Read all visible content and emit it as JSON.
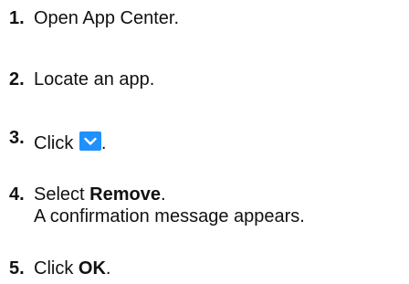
{
  "steps": [
    {
      "number": "1.",
      "text": "Open App Center."
    },
    {
      "number": "2.",
      "text": "Locate an app."
    },
    {
      "number": "3.",
      "text_before": "Click ",
      "icon": "chevron-down-icon",
      "text_after": "."
    },
    {
      "number": "4.",
      "text_before": "Select ",
      "bold": "Remove",
      "text_after": ".",
      "subtext": "A confirmation message appears."
    },
    {
      "number": "5.",
      "text_before": "Click ",
      "bold": "OK",
      "text_after": "."
    }
  ],
  "colors": {
    "text": "#111111",
    "icon_background": "#1e90ff",
    "icon_foreground": "#ffffff"
  }
}
